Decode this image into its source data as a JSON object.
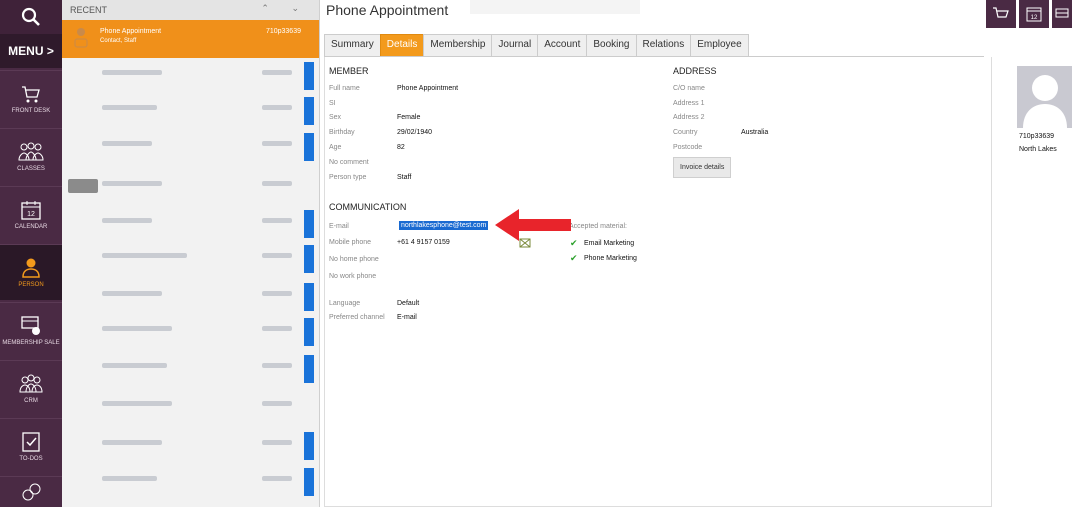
{
  "nav": {
    "menu_label": "MENU >",
    "items": [
      {
        "label": "FRONT DESK"
      },
      {
        "label": "CLASSES"
      },
      {
        "label": "CALENDAR",
        "calendar_number": "12"
      },
      {
        "label": "PERSON"
      },
      {
        "label": "MEMBERSHIP SALE"
      },
      {
        "label": "CRM"
      },
      {
        "label": "TO-DOS"
      }
    ]
  },
  "recent": {
    "header": "RECENT",
    "selected": {
      "name": "Phone Appointment",
      "sub": "Contact, Staff",
      "code": "710p33639"
    }
  },
  "main": {
    "title": "Phone Appointment",
    "tabs": [
      "Summary",
      "Details",
      "Membership",
      "Journal",
      "Account",
      "Booking",
      "Relations",
      "Employee"
    ],
    "active_tab": "Details",
    "topbar_calendar_number": "12"
  },
  "member": {
    "heading": "MEMBER",
    "fields": [
      {
        "label": "Full name",
        "value": "Phone Appointment"
      },
      {
        "label": "SI",
        "value": ""
      },
      {
        "label": "Sex",
        "value": "Female"
      },
      {
        "label": "Birthday",
        "value": "29/02/1940"
      },
      {
        "label": "Age",
        "value": "82"
      },
      {
        "label": "No comment",
        "value": ""
      },
      {
        "label": "Person type",
        "value": "Staff"
      }
    ]
  },
  "address": {
    "heading": "ADDRESS",
    "fields": [
      {
        "label": "C/O name",
        "value": ""
      },
      {
        "label": "Address 1",
        "value": ""
      },
      {
        "label": "Address 2",
        "value": ""
      },
      {
        "label": "Country",
        "value": "Australia"
      },
      {
        "label": "Postcode",
        "value": ""
      }
    ],
    "invoice_button": "Invoice details"
  },
  "communication": {
    "heading": "COMMUNICATION",
    "email_label": "E-mail",
    "email_value": "northlakesphone@test.com",
    "mobile_label": "Mobile phone",
    "mobile_value": "+61 4 9157 0159",
    "home_label": "No home phone",
    "work_label": "No work phone",
    "accepted_label": "Accepted material:",
    "accepted": [
      "Email Marketing",
      "Phone Marketing"
    ],
    "language_label": "Language",
    "language_value": "Default",
    "channel_label": "Preferred channel",
    "channel_value": "E-mail"
  },
  "photo": {
    "code": "710p33639",
    "location": "North Lakes"
  },
  "colors": {
    "nav": "#4a2a44",
    "accent": "#f39a1c",
    "highlight": "#1a6ad1",
    "arrow": "#e8242b"
  }
}
